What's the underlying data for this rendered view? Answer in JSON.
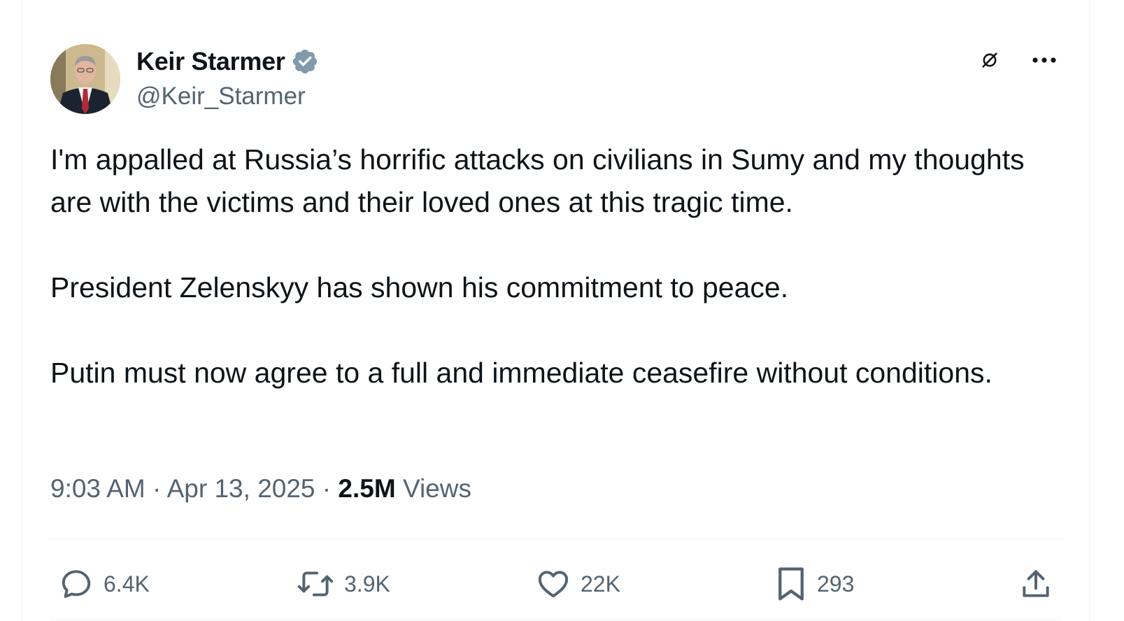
{
  "author": {
    "display_name": "Keir Starmer",
    "handle": "@Keir_Starmer",
    "verified": true,
    "verified_color": "#829aab"
  },
  "tweet": {
    "paragraphs": [
      "I'm appalled at Russia’s horrific attacks on civilians in Sumy and my thoughts are with the victims and their loved ones at this tragic time.",
      "President Zelenskyy has shown his commitment to peace.",
      "Putin must now agree to a full and immediate ceasefire without conditions."
    ]
  },
  "meta": {
    "time": "9:03 AM",
    "separator": "·",
    "date": "Apr 13, 2025",
    "views_count": "2.5M",
    "views_label": "Views"
  },
  "actions": {
    "replies": "6.4K",
    "reposts": "3.9K",
    "likes": "22K",
    "bookmarks": "293"
  },
  "icons": {
    "top_right": [
      "grok-icon",
      "more-icon"
    ],
    "action_bar": [
      "reply-icon",
      "repost-icon",
      "like-icon",
      "bookmark-icon",
      "share-icon"
    ]
  },
  "colors": {
    "text_primary": "#0f1419",
    "text_secondary": "#536471",
    "divider": "#eff3f4"
  }
}
